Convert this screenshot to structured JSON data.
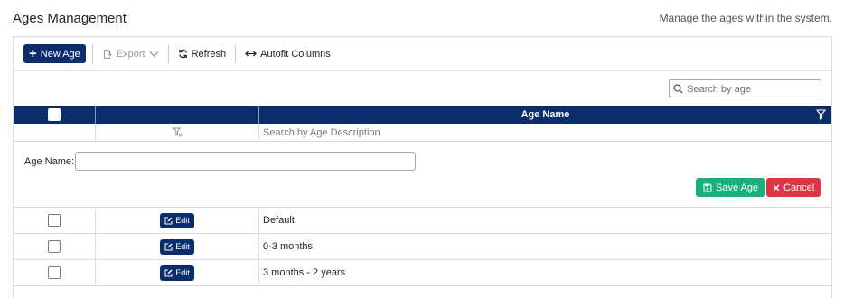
{
  "header": {
    "title": "Ages Management",
    "subtitle": "Manage the ages within the system."
  },
  "toolbar": {
    "new_label": "New Age",
    "export_label": "Export",
    "refresh_label": "Refresh",
    "autofit_label": "Autofit Columns"
  },
  "search": {
    "placeholder": "Search by age"
  },
  "columns": {
    "age_name": "Age Name"
  },
  "filter": {
    "placeholder": "Search by Age Description"
  },
  "form": {
    "label": "Age Name:",
    "value": "",
    "save_label": "Save Age",
    "cancel_label": "Cancel"
  },
  "rows": [
    {
      "edit_label": "Edit",
      "name": "Default"
    },
    {
      "edit_label": "Edit",
      "name": "0-3 months"
    },
    {
      "edit_label": "Edit",
      "name": "3 months - 2 years"
    }
  ],
  "colors": {
    "primary": "#0b2d6b",
    "save": "#1ab07b",
    "cancel": "#dc3545"
  },
  "icons": [
    "plus-icon",
    "export-icon",
    "chevron-down-icon",
    "refresh-icon",
    "autofit-icon",
    "search-icon",
    "filter-icon",
    "clear-filter-icon",
    "save-icon",
    "close-icon",
    "edit-icon"
  ]
}
